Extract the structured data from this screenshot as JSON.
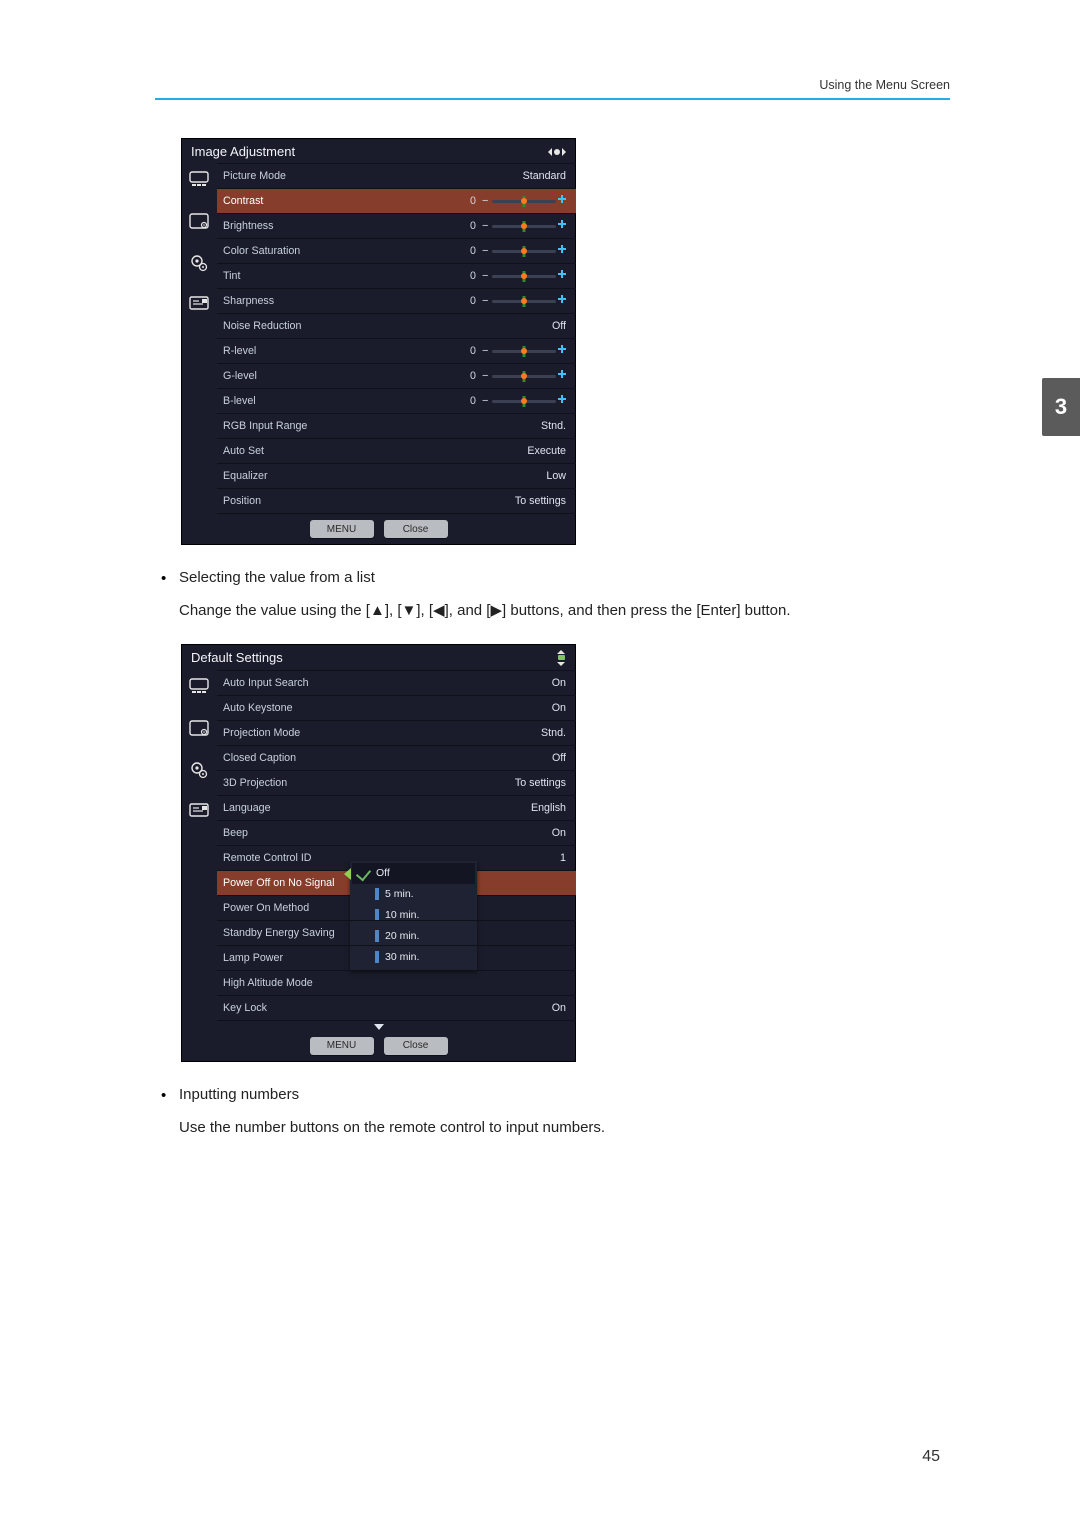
{
  "page": {
    "running_head": "Using the Menu Screen",
    "page_number": "45",
    "thumb_tab": "3"
  },
  "bullets": {
    "b1_lead": "Selecting the value from a list",
    "b1_sub_prefix": "Change the value using the [",
    "b1_sub_mid1": "], [",
    "b1_sub_mid2": "], [",
    "b1_sub_mid3": "], and [",
    "b1_sub_suffix": "] buttons, and then press the [Enter] button.",
    "b2_lead": "Inputting numbers",
    "b2_sub": "Use the number buttons on the remote control to input numbers."
  },
  "menu1": {
    "title": "Image Adjustment",
    "rows": [
      {
        "label": "Picture Mode",
        "value": "Standard",
        "type": "text"
      },
      {
        "label": "Contrast",
        "num": "0",
        "type": "slider",
        "hl": true
      },
      {
        "label": "Brightness",
        "num": "0",
        "type": "slider"
      },
      {
        "label": "Color Saturation",
        "num": "0",
        "type": "slider"
      },
      {
        "label": "Tint",
        "num": "0",
        "type": "slider"
      },
      {
        "label": "Sharpness",
        "num": "0",
        "type": "slider"
      },
      {
        "label": "Noise Reduction",
        "value": "Off",
        "type": "text"
      },
      {
        "label": "R-level",
        "num": "0",
        "type": "slider"
      },
      {
        "label": "G-level",
        "num": "0",
        "type": "slider"
      },
      {
        "label": "B-level",
        "num": "0",
        "type": "slider"
      },
      {
        "label": "RGB Input Range",
        "value": "Stnd.",
        "type": "text"
      },
      {
        "label": "Auto Set",
        "value": "Execute",
        "type": "text"
      },
      {
        "label": "Equalizer",
        "value": "Low",
        "type": "text"
      },
      {
        "label": "Position",
        "value": "To settings",
        "type": "text"
      }
    ],
    "footer": {
      "menu": "MENU",
      "close": "Close"
    }
  },
  "menu2": {
    "title": "Default Settings",
    "rows": [
      {
        "label": "Auto Input Search",
        "value": "On"
      },
      {
        "label": "Auto Keystone",
        "value": "On"
      },
      {
        "label": "Projection Mode",
        "value": "Stnd."
      },
      {
        "label": "Closed Caption",
        "value": "Off"
      },
      {
        "label": "3D Projection",
        "value": "To settings"
      },
      {
        "label": "Language",
        "value": "English"
      },
      {
        "label": "Beep",
        "value": "On"
      },
      {
        "label": "Remote Control ID",
        "value": "1"
      },
      {
        "label": "Power Off on No Signal",
        "value": "",
        "hl": true,
        "popup": true
      },
      {
        "label": "Power On Method",
        "value": ""
      },
      {
        "label": "Standby Energy Saving",
        "value": ""
      },
      {
        "label": "Lamp Power",
        "value": ""
      },
      {
        "label": "High Altitude Mode",
        "value": ""
      },
      {
        "label": "Key Lock",
        "value": "On"
      }
    ],
    "popup_options": [
      "Off",
      "5 min.",
      "10 min.",
      "20 min.",
      "30 min."
    ],
    "popup_selected": 0,
    "footer": {
      "menu": "MENU",
      "close": "Close"
    }
  }
}
